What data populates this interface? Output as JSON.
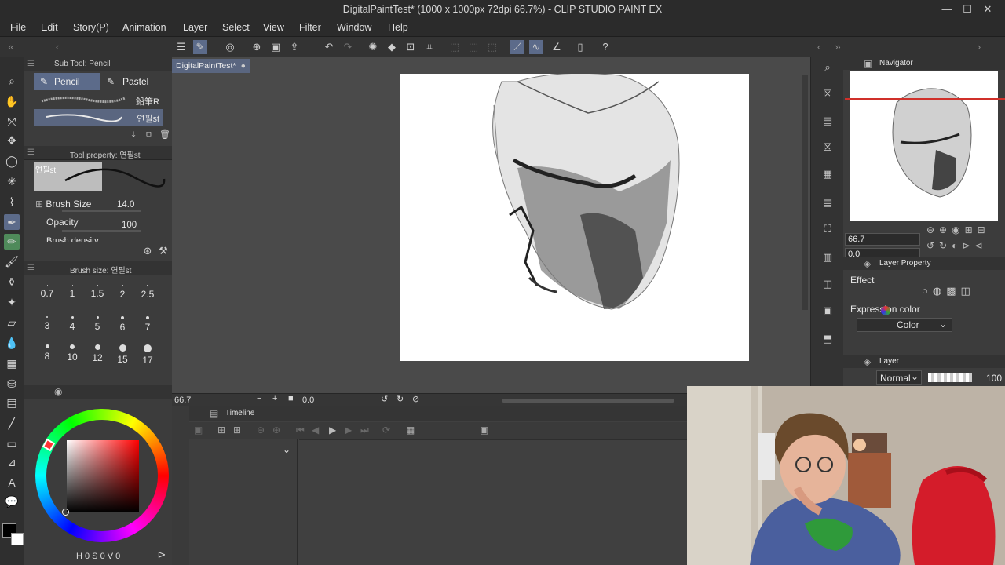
{
  "window": {
    "title": "DigitalPaintTest* (1000 x 1000px 72dpi 66.7%) - CLIP STUDIO PAINT EX"
  },
  "menu": [
    "File",
    "Edit",
    "Story(P)",
    "Animation",
    "Layer",
    "Select",
    "View",
    "Filter",
    "Window",
    "Help"
  ],
  "subtool": {
    "header": "Sub Tool: Pencil",
    "tabs": [
      "Pencil",
      "Pastel"
    ],
    "brushes": [
      "鉛筆R",
      "연필st"
    ]
  },
  "tool_property": {
    "header": "Tool property: 연필st",
    "preview_label": "연필st",
    "brush_size_label": "Brush Size",
    "brush_size_value": "14.0",
    "opacity_label": "Opacity",
    "opacity_value": "100",
    "density_label": "Brush density"
  },
  "brush_size_panel": {
    "header": "Brush size: 연필st",
    "sizes": [
      "0.7",
      "1",
      "1.5",
      "2",
      "2.5",
      "3",
      "4",
      "5",
      "6",
      "7",
      "8",
      "10",
      "12",
      "15",
      "17"
    ]
  },
  "document": {
    "tab_label": "DigitalPaintTest*"
  },
  "status": {
    "zoom": "66.7",
    "rotation": "0.0"
  },
  "timeline": {
    "header": "Timeline"
  },
  "navigator": {
    "header": "Navigator",
    "zoom": "66.7",
    "rotation": "0.0"
  },
  "layer_property": {
    "header": "Layer Property",
    "effect_label": "Effect",
    "expression_color_label": "Expression color",
    "expression_color_value": "Color"
  },
  "layer": {
    "header": "Layer",
    "blend_mode": "Normal",
    "opacity": "100"
  },
  "color_panel": {
    "readout": "H 0 S 0 V 0"
  },
  "colors": {
    "accent": "#5c6b8a",
    "selected_tool": "#4f8a5a",
    "ruler": "#d0302a"
  }
}
